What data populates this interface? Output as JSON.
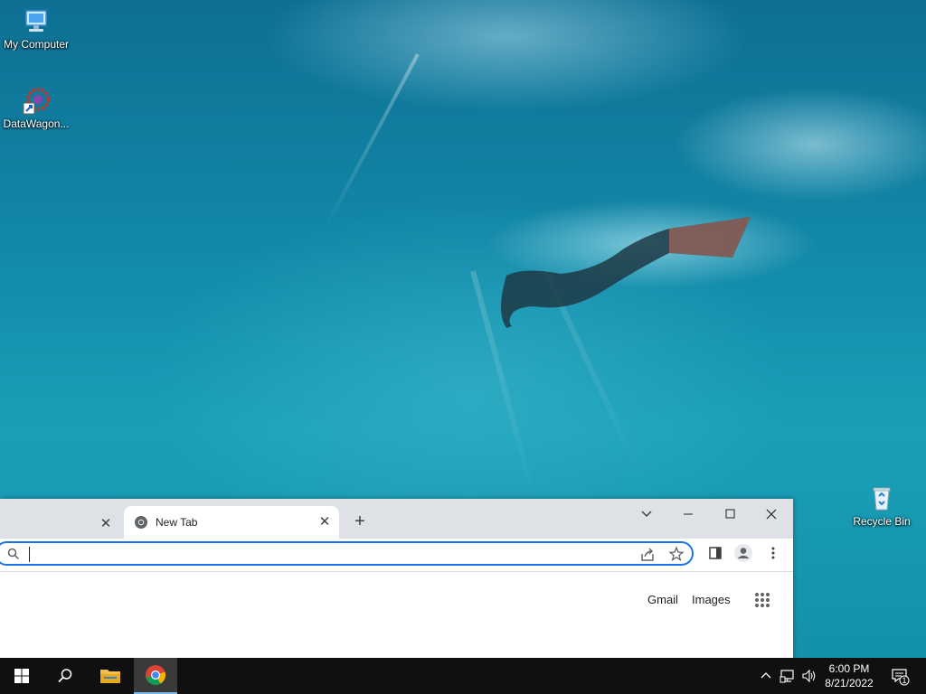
{
  "desktop": {
    "icons": [
      {
        "label": "My Computer",
        "icon": "computer-icon"
      },
      {
        "label": "DataWagon...",
        "icon": "datawagon-shortcut-icon"
      },
      {
        "label": "Recycle Bin",
        "icon": "recycle-bin-icon"
      }
    ]
  },
  "browser": {
    "inactive_tab_close": "✕",
    "active_tab": {
      "title": "New Tab",
      "close": "✕",
      "favicon": "chrome-icon"
    },
    "new_tab_label": "+",
    "omnibox": {
      "value": "",
      "placeholder": ""
    },
    "links": {
      "gmail": "Gmail",
      "images": "Images"
    },
    "accent_color": "#1a73e8"
  },
  "taskbar": {
    "apps": [
      "windows-start-icon",
      "search-icon",
      "file-explorer-icon",
      "chrome-icon"
    ],
    "clock": {
      "time": "6:00 PM",
      "date": "8/21/2022"
    },
    "notification_count": "1"
  }
}
